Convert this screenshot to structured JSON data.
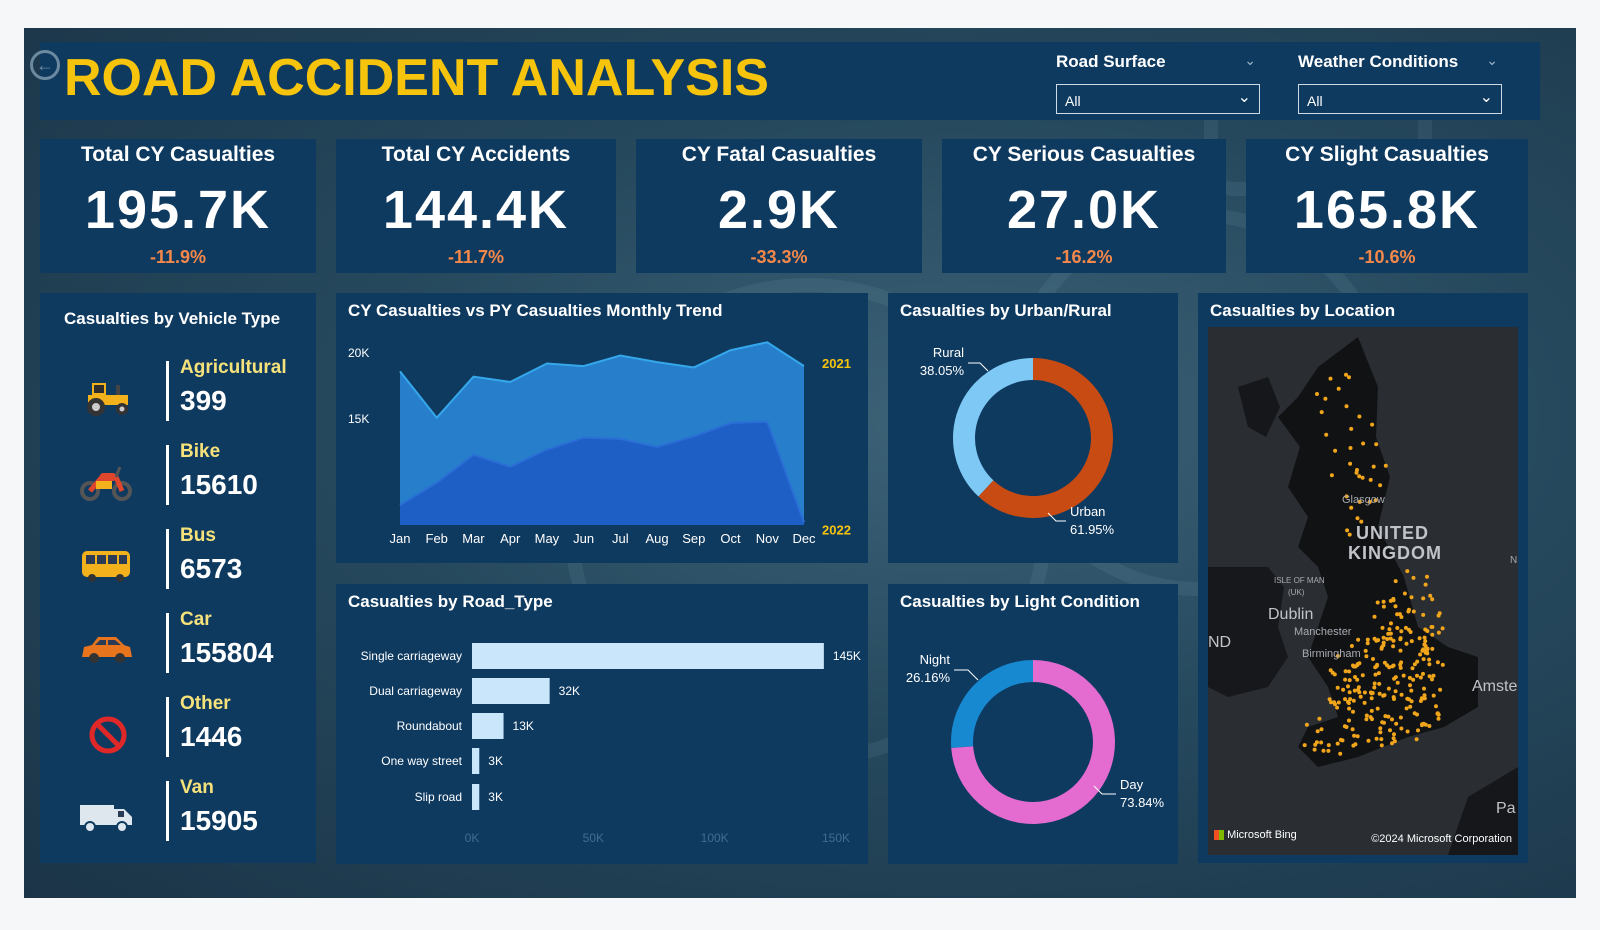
{
  "header": {
    "title": "ROAD ACCIDENT ANALYSIS",
    "back_icon": "back-arrow-icon",
    "slicers": [
      {
        "label": "Road Surface",
        "value": "All"
      },
      {
        "label": "Weather Conditions",
        "value": "All"
      }
    ]
  },
  "kpis": [
    {
      "title": "Total CY Casualties",
      "value": "195.7K",
      "change": "-11.9%"
    },
    {
      "title": "Total CY Accidents",
      "value": "144.4K",
      "change": "-11.7%"
    },
    {
      "title": "CY Fatal Casualties",
      "value": "2.9K",
      "change": "-33.3%"
    },
    {
      "title": "CY Serious Casualties",
      "value": "27.0K",
      "change": "-16.2%"
    },
    {
      "title": "CY Slight Casualties",
      "value": "165.8K",
      "change": "-10.6%"
    }
  ],
  "vehicle_panel": {
    "title": "Casualties by Vehicle Type",
    "items": [
      {
        "name": "Agricultural",
        "count": "399",
        "icon": "tractor-icon"
      },
      {
        "name": "Bike",
        "count": "15610",
        "icon": "motorbike-icon"
      },
      {
        "name": "Bus",
        "count": "6573",
        "icon": "bus-icon"
      },
      {
        "name": "Car",
        "count": "155804",
        "icon": "car-icon"
      },
      {
        "name": "Other",
        "count": "1446",
        "icon": "prohibited-icon"
      },
      {
        "name": "Van",
        "count": "15905",
        "icon": "van-icon"
      }
    ]
  },
  "map_panel": {
    "title": "Casualties by Location",
    "labels": [
      "UNITED",
      "KINGDOM",
      "Dublin",
      "ISLE OF MAN",
      "(UK)",
      "Manchester",
      "Birmingham",
      "Glasgow",
      "Amste",
      "ND",
      "Pa",
      "N"
    ],
    "attribution_left": "Microsoft Bing",
    "attribution_right": "©2024 Microsoft Corporation"
  },
  "colors": {
    "title_yellow": "#f6c40c",
    "change_orange": "#f4884a",
    "panel_bg": "#0f3a60",
    "cy_area": "#1e5fc6",
    "py_area": "#2a86d6",
    "urban": "#c74b12",
    "rural": "#7ec8f5",
    "day": "#e46bd0",
    "night": "#1789d1",
    "bar": "#c9e6fb"
  },
  "chart_data": [
    {
      "type": "area",
      "title": "CY Casualties vs PY Casualties Monthly Trend",
      "categories": [
        "Jan",
        "Feb",
        "Mar",
        "Apr",
        "May",
        "Jun",
        "Jul",
        "Aug",
        "Sep",
        "Oct",
        "Nov",
        "Dec"
      ],
      "yticks": [
        "15K",
        "20K"
      ],
      "ylim": [
        7000,
        21500
      ],
      "series": [
        {
          "name": "2021",
          "values": [
            18600,
            15100,
            18200,
            17800,
            19200,
            19000,
            19800,
            19300,
            18900,
            20200,
            20800,
            19000
          ]
        },
        {
          "name": "2022",
          "values": [
            8500,
            10200,
            12300,
            11400,
            12700,
            13600,
            13500,
            12900,
            13700,
            14700,
            14800,
            7200
          ]
        }
      ]
    },
    {
      "type": "pie",
      "title": "Casualties by Urban/Rural",
      "labels": [
        "Rural",
        "Urban"
      ],
      "values": [
        38.05,
        61.95
      ],
      "value_labels": [
        "38.05%",
        "61.95%"
      ]
    },
    {
      "type": "bar",
      "title": "Casualties by Road_Type",
      "categories": [
        "Single carriageway",
        "Dual carriageway",
        "Roundabout",
        "One way street",
        "Slip road"
      ],
      "values": [
        145000,
        32000,
        13000,
        3000,
        3000
      ],
      "value_labels": [
        "145K",
        "32K",
        "13K",
        "3K",
        "3K"
      ],
      "xticks": [
        "0K",
        "50K",
        "100K",
        "150K"
      ],
      "xlim": [
        0,
        150000
      ]
    },
    {
      "type": "pie",
      "title": "Casualties by Light Condition",
      "labels": [
        "Night",
        "Day"
      ],
      "values": [
        26.16,
        73.84
      ],
      "value_labels": [
        "26.16%",
        "73.84%"
      ]
    }
  ]
}
